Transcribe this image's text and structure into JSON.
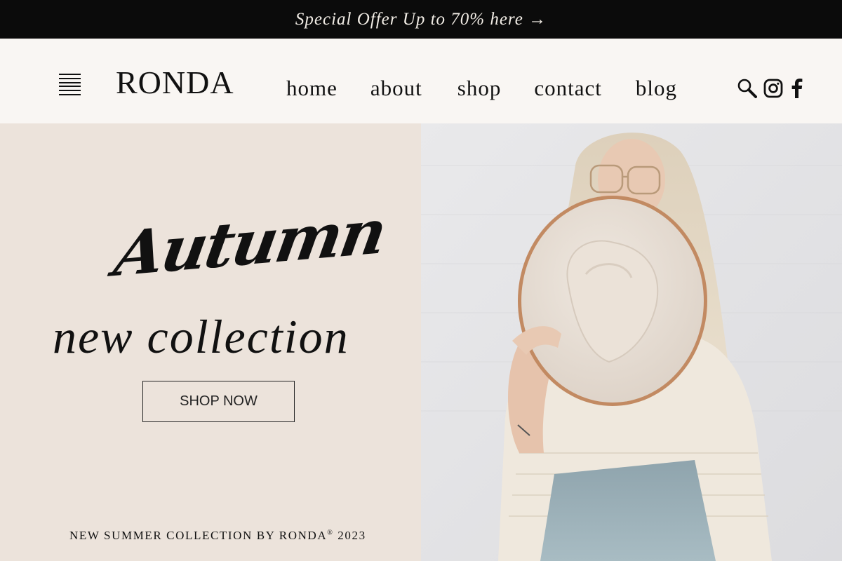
{
  "promo": {
    "text": "Special Offer Up to 70% here →"
  },
  "header": {
    "logo": "RONDA",
    "nav": [
      "home",
      "about",
      "shop",
      "contact",
      "blog"
    ],
    "icons": [
      "menu-icon",
      "search-icon",
      "instagram-icon",
      "facebook-icon"
    ]
  },
  "hero": {
    "script_title": "Autumn",
    "title": "new collection",
    "cta": "SHOP NOW",
    "caption": "NEW SUMMER COLLECTION BY RONDA",
    "caption_mark": "®",
    "caption_year": " 2023"
  },
  "colors": {
    "promo_bg": "#0b0b0b",
    "header_bg": "#f9f6f3",
    "hero_left_bg": "#ece3db",
    "hero_right_bg": "#e4e4e6",
    "hat": "#e8dfd6",
    "hat_band": "#c28a62",
    "sweater": "#efe8dd",
    "jeans": "#9bb0b8",
    "hair": "#e4d7c1"
  }
}
